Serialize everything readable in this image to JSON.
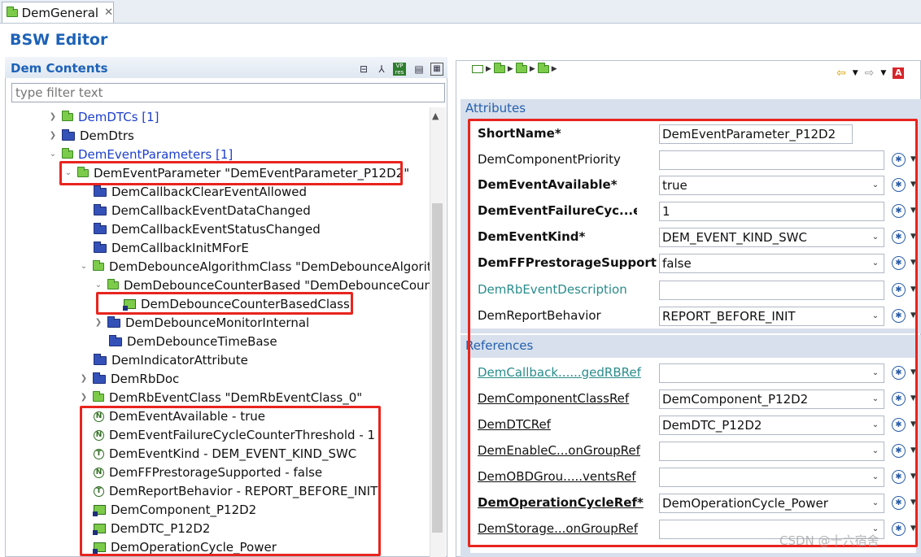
{
  "tab": {
    "label": "DemGeneral",
    "close_glyph": "✕"
  },
  "editor_title": "BSW Editor",
  "contents": {
    "label": "Dem Contents",
    "filter_placeholder": "type filter text"
  },
  "tree": [
    {
      "text": "DemDTCs [1]",
      "link": true
    },
    {
      "text": "DemDtrs",
      "link": false
    },
    {
      "text": "DemEventParameters [1]",
      "link": true
    },
    {
      "text": "DemEventParameter \"DemEventParameter_P12D2\""
    },
    {
      "text": "DemCallbackClearEventAllowed"
    },
    {
      "text": "DemCallbackEventDataChanged"
    },
    {
      "text": "DemCallbackEventStatusChanged"
    },
    {
      "text": "DemCallbackInitMForE"
    },
    {
      "text": "DemDebounceAlgorithmClass \"DemDebounceAlgorit"
    },
    {
      "text": "DemDebounceCounterBased \"DemDebounceCount"
    },
    {
      "text": "DemDebounceCounterBasedClass"
    },
    {
      "text": "DemDebounceMonitorInternal"
    },
    {
      "text": "DemDebounceTimeBase"
    },
    {
      "text": "DemIndicatorAttribute"
    },
    {
      "text": "DemRbDoc"
    },
    {
      "text": "DemRbEventClass \"DemRbEventClass_0\""
    },
    {
      "text": "DemEventAvailable - true",
      "badge": "N"
    },
    {
      "text": "DemEventFailureCycleCounterThreshold - 1",
      "badge": "N"
    },
    {
      "text": "DemEventKind - DEM_EVENT_KIND_SWC",
      "badge": "T"
    },
    {
      "text": "DemFFPrestorageSupported - false",
      "badge": "N"
    },
    {
      "text": "DemReportBehavior - REPORT_BEFORE_INIT",
      "badge": "T"
    },
    {
      "text": "DemComponent_P12D2"
    },
    {
      "text": "DemDTC_P12D2"
    },
    {
      "text": "DemOperationCycle_Power"
    }
  ],
  "attributes": {
    "title": "Attributes",
    "fields": [
      {
        "label": "ShortName*",
        "value": "DemEventParameter_P12D2"
      },
      {
        "label": "DemComponentPriority",
        "value": ""
      },
      {
        "label": "DemEventAvailable*",
        "value": "true"
      },
      {
        "label": "DemEventFailureCyc...eshold",
        "value": "1"
      },
      {
        "label": "DemEventKind*",
        "value": "DEM_EVENT_KIND_SWC"
      },
      {
        "label": "DemFFPrestorageSupport",
        "value": "false"
      },
      {
        "label": "DemRbEventDescription",
        "value": ""
      },
      {
        "label": "DemReportBehavior",
        "value": "REPORT_BEFORE_INIT"
      }
    ]
  },
  "references": {
    "title": "References",
    "fields": [
      {
        "label": "DemCallback......gedRBRef",
        "value": ""
      },
      {
        "label": "DemComponentClassRef",
        "value": "DemComponent_P12D2"
      },
      {
        "label": "DemDTCRef",
        "value": "DemDTC_P12D2"
      },
      {
        "label": "DemEnableC...onGroupRef",
        "value": ""
      },
      {
        "label": "DemOBDGrou.....ventsRef",
        "value": ""
      },
      {
        "label": "DemOperationCycleRef*",
        "value": "DemOperationCycle_Power"
      },
      {
        "label": "DemStorage...onGroupRef",
        "value": ""
      }
    ]
  },
  "watermark": "CSDN @十六宿舍",
  "colors": {
    "highlight": "#e8241e",
    "accent": "#1d62b7"
  }
}
